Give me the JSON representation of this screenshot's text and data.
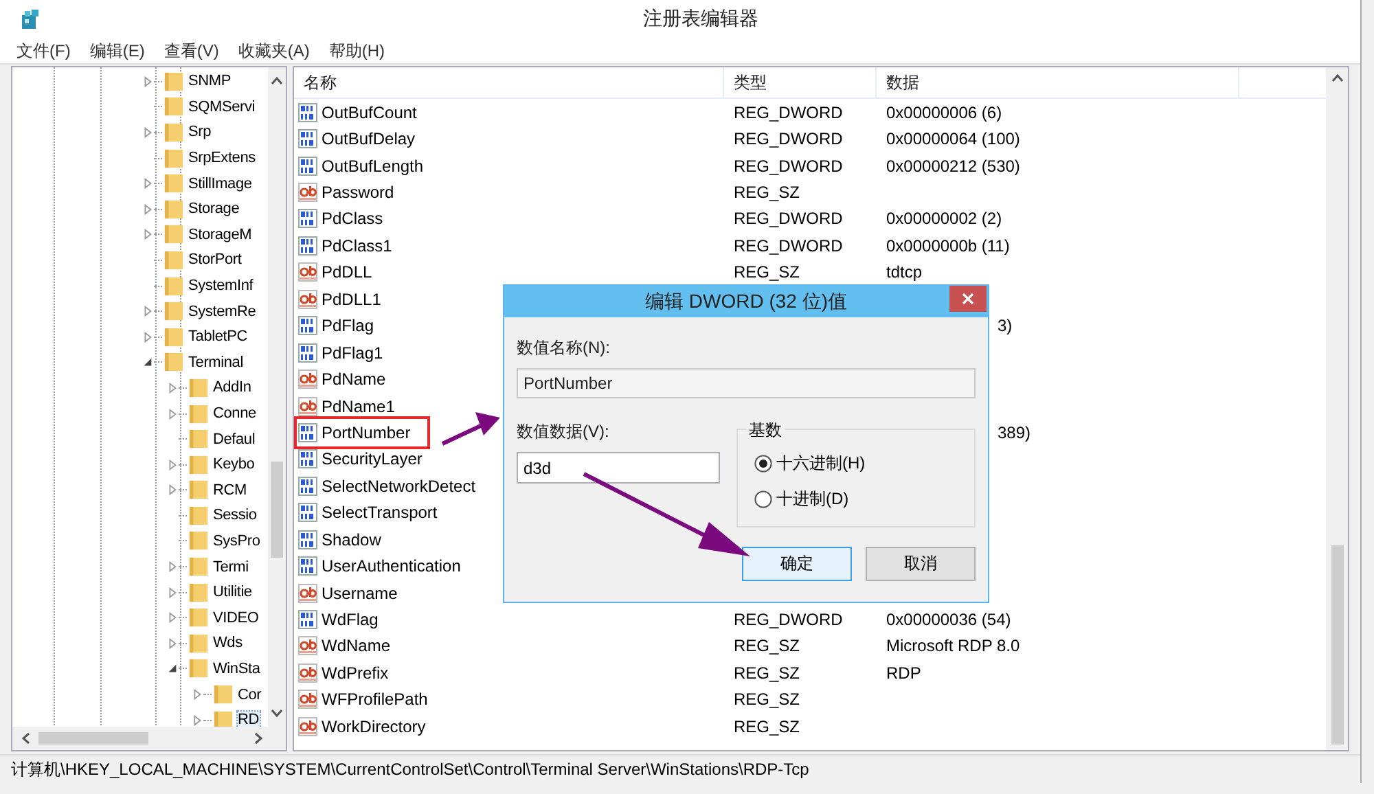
{
  "window": {
    "title": "注册表编辑器"
  },
  "menu": [
    "文件(F)",
    "编辑(E)",
    "查看(V)",
    "收藏夹(A)",
    "帮助(H)"
  ],
  "tree": {
    "items": [
      {
        "label": "SNMP",
        "kind": "branch",
        "expanded": false,
        "selected": false
      },
      {
        "label": "SQMServi",
        "kind": "leaf",
        "selected": false
      },
      {
        "label": "Srp",
        "kind": "branch",
        "expanded": false,
        "selected": false
      },
      {
        "label": "SrpExtens",
        "kind": "leaf",
        "selected": false
      },
      {
        "label": "StillImage",
        "kind": "branch",
        "expanded": false,
        "selected": false
      },
      {
        "label": "Storage",
        "kind": "branch",
        "expanded": false,
        "selected": false
      },
      {
        "label": "StorageM",
        "kind": "branch",
        "expanded": false,
        "selected": false
      },
      {
        "label": "StorPort",
        "kind": "leaf",
        "selected": false
      },
      {
        "label": "SystemInf",
        "kind": "leaf",
        "selected": false
      },
      {
        "label": "SystemRe",
        "kind": "branch",
        "expanded": false,
        "selected": false
      },
      {
        "label": "TabletPC",
        "kind": "branch",
        "expanded": false,
        "selected": false
      },
      {
        "label": "Terminal",
        "kind": "branch",
        "expanded": true,
        "selected": false,
        "children": [
          {
            "label": "AddIn",
            "kind": "branch",
            "expanded": false,
            "selected": false
          },
          {
            "label": "Conne",
            "kind": "branch",
            "expanded": false,
            "selected": false
          },
          {
            "label": "Defaul",
            "kind": "leaf",
            "selected": false
          },
          {
            "label": "Keybo",
            "kind": "branch",
            "expanded": false,
            "selected": false
          },
          {
            "label": "RCM",
            "kind": "branch",
            "expanded": false,
            "selected": false
          },
          {
            "label": "Sessio",
            "kind": "leaf",
            "selected": false
          },
          {
            "label": "SysPro",
            "kind": "leaf",
            "selected": false
          },
          {
            "label": "Termi",
            "kind": "branch",
            "expanded": false,
            "selected": false
          },
          {
            "label": "Utilitie",
            "kind": "branch",
            "expanded": false,
            "selected": false
          },
          {
            "label": "VIDEO",
            "kind": "branch",
            "expanded": false,
            "selected": false
          },
          {
            "label": "Wds",
            "kind": "branch",
            "expanded": false,
            "selected": false
          },
          {
            "label": "WinSta",
            "kind": "branch",
            "expanded": true,
            "selected": false,
            "children": [
              {
                "label": "Cor",
                "kind": "branch",
                "expanded": false,
                "selected": false
              },
              {
                "label": "RD",
                "kind": "branch",
                "expanded": false,
                "selected": true
              }
            ]
          }
        ]
      }
    ]
  },
  "table": {
    "columns": [
      "名称",
      "类型",
      "数据"
    ],
    "rows": [
      {
        "name": "OutBufCount",
        "kind": "dword",
        "type": "REG_DWORD",
        "data": "0x00000006 (6)",
        "covered": false,
        "highlighted": false
      },
      {
        "name": "OutBufDelay",
        "kind": "dword",
        "type": "REG_DWORD",
        "data": "0x00000064 (100)",
        "covered": false,
        "highlighted": false
      },
      {
        "name": "OutBufLength",
        "kind": "dword",
        "type": "REG_DWORD",
        "data": "0x00000212 (530)",
        "covered": false,
        "highlighted": false
      },
      {
        "name": "Password",
        "kind": "sz",
        "type": "REG_SZ",
        "covered": false,
        "highlighted": false
      },
      {
        "name": "PdClass",
        "kind": "dword",
        "type": "REG_DWORD",
        "data": "0x00000002 (2)",
        "covered": false,
        "highlighted": false
      },
      {
        "name": "PdClass1",
        "kind": "dword",
        "type": "REG_DWORD",
        "data": "0x0000000b (11)",
        "covered": false,
        "highlighted": false
      },
      {
        "name": "PdDLL",
        "kind": "sz",
        "type": "REG_SZ",
        "data": "tdtcp",
        "covered": false,
        "highlighted": false
      },
      {
        "name": "PdDLL1",
        "kind": "sz",
        "highlighted": false
      },
      {
        "name": "PdFlag",
        "kind": "dword",
        "data": "3)",
        "covered": true,
        "highlighted": false
      },
      {
        "name": "PdFlag1",
        "kind": "dword",
        "highlighted": false
      },
      {
        "name": "PdName",
        "kind": "sz",
        "highlighted": false
      },
      {
        "name": "PdName1",
        "kind": "sz",
        "highlighted": false
      },
      {
        "name": "PortNumber",
        "kind": "dword",
        "data": "389)",
        "covered": true,
        "highlighted": true
      },
      {
        "name": "SecurityLayer",
        "kind": "dword",
        "highlighted": false
      },
      {
        "name": "SelectNetworkDetect",
        "kind": "dword",
        "highlighted": false
      },
      {
        "name": "SelectTransport",
        "kind": "dword",
        "highlighted": false
      },
      {
        "name": "Shadow",
        "kind": "dword",
        "highlighted": false
      },
      {
        "name": "UserAuthentication",
        "kind": "dword",
        "highlighted": false
      },
      {
        "name": "Username",
        "kind": "sz",
        "highlighted": false
      },
      {
        "name": "WdFlag",
        "kind": "dword",
        "type": "REG_DWORD",
        "data": "0x00000036 (54)",
        "covered": false,
        "highlighted": false
      },
      {
        "name": "WdName",
        "kind": "sz",
        "type": "REG_SZ",
        "data": "Microsoft RDP 8.0",
        "covered": false,
        "highlighted": false
      },
      {
        "name": "WdPrefix",
        "kind": "sz",
        "type": "REG_SZ",
        "data": "RDP",
        "covered": false,
        "highlighted": false
      },
      {
        "name": "WFProfilePath",
        "kind": "sz",
        "type": "REG_SZ",
        "covered": false,
        "highlighted": false
      },
      {
        "name": "WorkDirectory",
        "kind": "sz",
        "type": "REG_SZ",
        "covered": false,
        "highlighted": false
      }
    ]
  },
  "dialog": {
    "title": "编辑 DWORD (32 位)值",
    "name_label": "数值名称(N):",
    "name_value": "PortNumber",
    "data_label": "数值数据(V):",
    "data_value": "d3d",
    "base_label": "基数",
    "bases": [
      {
        "label": "十六进制(H)",
        "selected": true
      },
      {
        "label": "十进制(D)",
        "selected": false
      }
    ],
    "buttons": [
      {
        "label": "确定",
        "focused": true
      },
      {
        "label": "取消",
        "focused": false
      }
    ]
  },
  "status_bar": "计算机\\HKEY_LOCAL_MACHINE\\SYSTEM\\CurrentControlSet\\Control\\Terminal Server\\WinStations\\RDP-Tcp"
}
